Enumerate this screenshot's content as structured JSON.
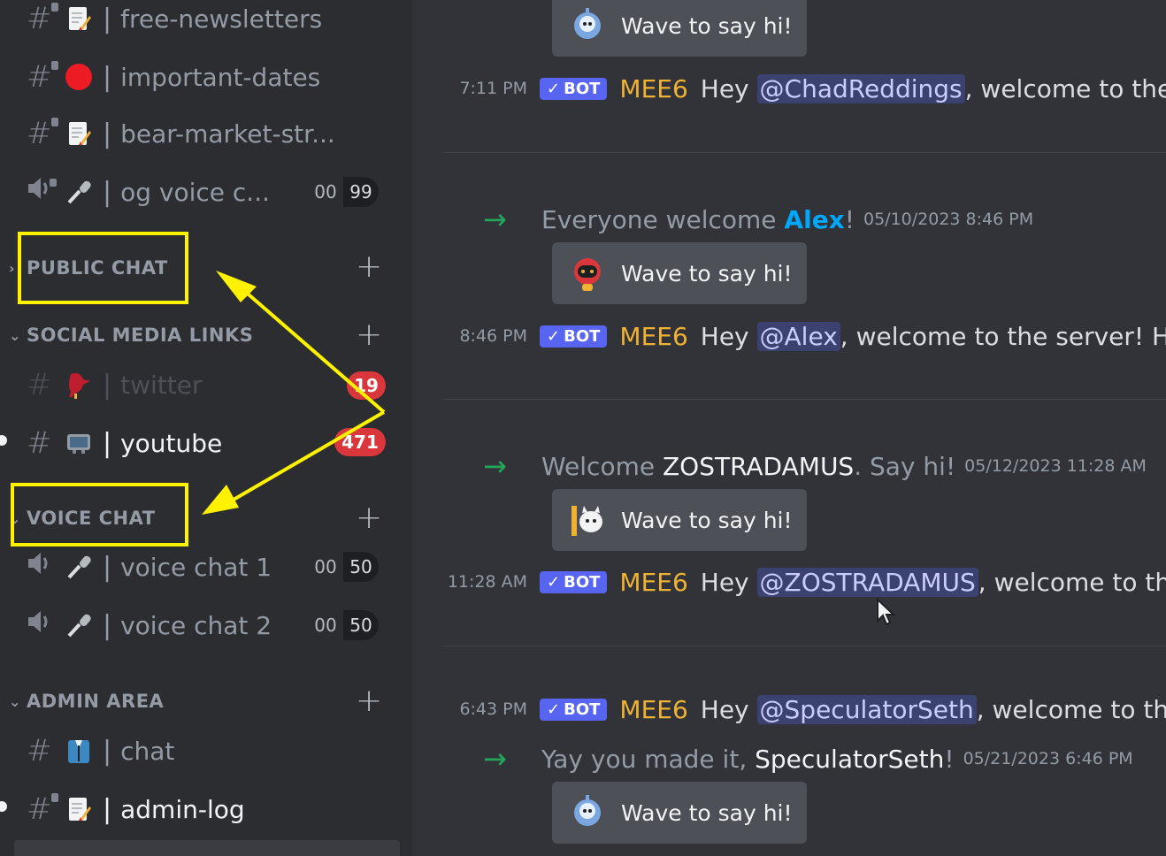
{
  "sidebar": {
    "channels_top": [
      {
        "label": "free-newsletters",
        "emoji_icon": "memo-icon"
      },
      {
        "label": "important-dates",
        "emoji_icon": "red-circle-icon"
      },
      {
        "label": "bear-market-str...",
        "emoji_icon": "memo-icon"
      },
      {
        "label": "og voice c...",
        "emoji_icon": "microphone-icon",
        "count_a": "00",
        "count_b": "99"
      }
    ],
    "categories": {
      "public_chat": "PUBLIC CHAT",
      "social_media": "SOCIAL MEDIA LINKS",
      "voice_chat": "VOICE CHAT",
      "admin_area": "ADMIN AREA"
    },
    "social_channels": [
      {
        "label": "twitter",
        "badge": "19"
      },
      {
        "label": "youtube",
        "badge": "471"
      }
    ],
    "voice_channels": [
      {
        "label": "voice chat 1",
        "count_a": "00",
        "count_b": "50"
      },
      {
        "label": "voice chat 2",
        "count_a": "00",
        "count_b": "50"
      }
    ],
    "admin_channels": [
      {
        "label": "chat"
      },
      {
        "label": "admin-log"
      }
    ],
    "plus": "+",
    "bar": "|",
    "hash": "#"
  },
  "messages": {
    "wave_label": "Wave to say hi!",
    "bot_tag": "BOT",
    "bot_check": "✓",
    "bot_author": "MEE6",
    "rows": [
      {
        "time": "7:11 PM",
        "pre": "Hey ",
        "mention": "@ChadReddings",
        "post": ", welcome to the s"
      },
      {
        "time": "8:46 PM",
        "pre": "Hey ",
        "mention": "@Alex",
        "post": ", welcome to the server! How"
      },
      {
        "time": "11:28 AM",
        "pre": "Hey ",
        "mention": "@ZOSTRADAMUS",
        "post": ", welcome to the"
      },
      {
        "time": "6:43 PM",
        "pre": "Hey ",
        "mention": "@SpeculatorSeth",
        "post": ", welcome to the"
      }
    ],
    "joins": [
      {
        "pre": "Everyone welcome ",
        "who": "Alex",
        "post": "!",
        "stamp": "05/10/2023 8:46 PM"
      },
      {
        "pre": "Welcome ",
        "who": "ZOSTRADAMUS",
        "post": ". Say hi!",
        "stamp": "05/12/2023 11:28 AM"
      },
      {
        "pre": "Yay you made it, ",
        "who": "SpeculatorSeth",
        "post": "!",
        "stamp": "05/21/2023 6:46 PM"
      }
    ],
    "join_arrow": "→"
  },
  "colors": {
    "highlight": "#fff200",
    "bot_tag": "#5865f2",
    "mee6": "#f0b232",
    "badge": "#da373c",
    "join_arrow": "#23a55a"
  }
}
